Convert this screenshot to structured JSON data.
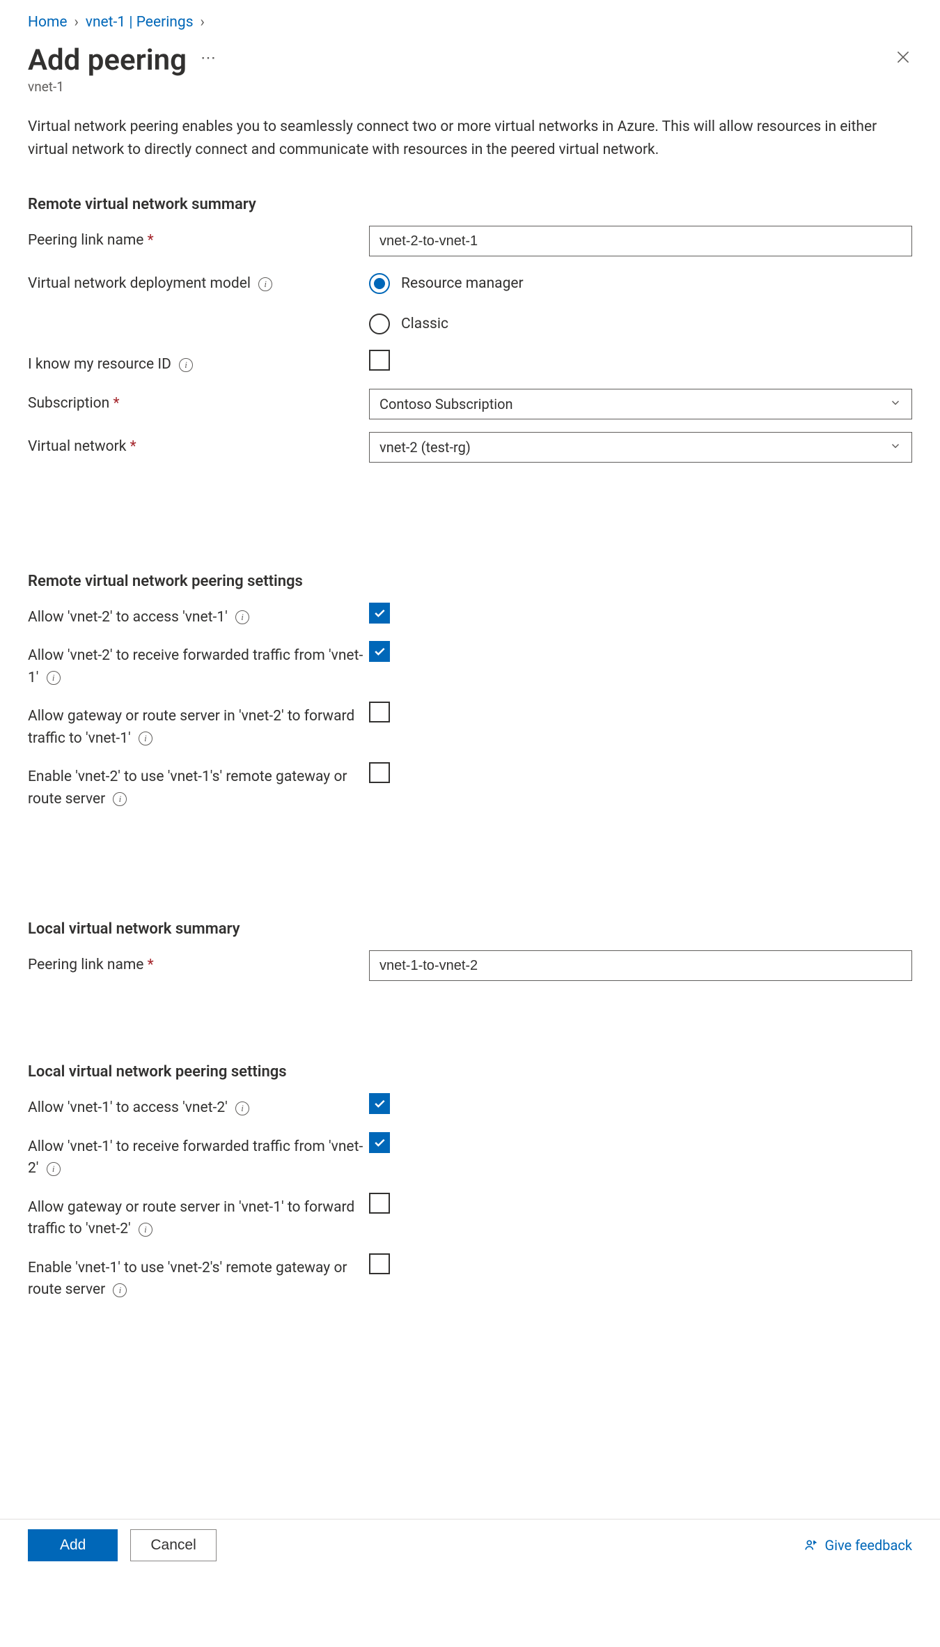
{
  "breadcrumbs": {
    "home": "Home",
    "parent": "vnet-1 | Peerings"
  },
  "title": "Add peering",
  "subtitle": "vnet-1",
  "description": "Virtual network peering enables you to seamlessly connect two or more virtual networks in Azure. This will allow resources in either virtual network to directly connect and communicate with resources in the peered virtual network.",
  "sections": {
    "remote_summary": "Remote virtual network summary",
    "remote_settings": "Remote virtual network peering settings",
    "local_summary": "Local virtual network summary",
    "local_settings": "Local virtual network peering settings"
  },
  "remote": {
    "peering_link_name_label": "Peering link name",
    "peering_link_name_value": "vnet-2-to-vnet-1",
    "deployment_model_label": "Virtual network deployment model",
    "deployment_model_options": {
      "rm": "Resource manager",
      "classic": "Classic"
    },
    "deployment_model_selected": "rm",
    "know_resource_id_label": "I know my resource ID",
    "know_resource_id_checked": false,
    "subscription_label": "Subscription",
    "subscription_value": "Contoso Subscription",
    "virtual_network_label": "Virtual network",
    "virtual_network_value": "vnet-2 (test-rg)"
  },
  "remote_settings": {
    "allow_access": {
      "label": "Allow 'vnet-2' to access 'vnet-1'",
      "checked": true
    },
    "allow_forwarded": {
      "label": "Allow 'vnet-2' to receive forwarded traffic from 'vnet-1'",
      "checked": true
    },
    "allow_gateway": {
      "label": "Allow gateway or route server in 'vnet-2' to forward traffic to 'vnet-1'",
      "checked": false
    },
    "use_remote_gateway": {
      "label": "Enable 'vnet-2' to use 'vnet-1's' remote gateway or route server",
      "checked": false
    }
  },
  "local": {
    "peering_link_name_label": "Peering link name",
    "peering_link_name_value": "vnet-1-to-vnet-2"
  },
  "local_settings": {
    "allow_access": {
      "label": "Allow 'vnet-1' to access 'vnet-2'",
      "checked": true
    },
    "allow_forwarded": {
      "label": "Allow 'vnet-1' to receive forwarded traffic from 'vnet-2'",
      "checked": true
    },
    "allow_gateway": {
      "label": "Allow gateway or route server in 'vnet-1' to forward traffic to 'vnet-2'",
      "checked": false
    },
    "use_remote_gateway": {
      "label": "Enable 'vnet-1' to use 'vnet-2's' remote gateway or route server",
      "checked": false
    }
  },
  "footer": {
    "add": "Add",
    "cancel": "Cancel",
    "feedback": "Give feedback"
  }
}
